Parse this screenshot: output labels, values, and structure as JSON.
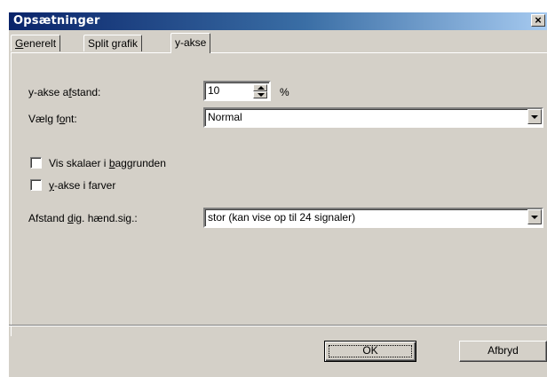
{
  "window": {
    "title": "Opsætninger",
    "close_glyph": "×"
  },
  "tabs": [
    {
      "label_pre": "",
      "mnemonic": "G",
      "label_post": "enerelt",
      "active": false
    },
    {
      "label_pre": "Split grafik",
      "mnemonic": "",
      "label_post": "",
      "active": false
    },
    {
      "label_pre": "y-akse",
      "mnemonic": "",
      "label_post": "",
      "active": true
    }
  ],
  "form": {
    "axis_distance": {
      "label_pre": "y-akse a",
      "mnemonic": "f",
      "label_post": "stand:",
      "value": "10",
      "unit": "%"
    },
    "font": {
      "label_pre": "Vælg f",
      "mnemonic": "o",
      "label_post": "nt:",
      "value": "Normal"
    },
    "show_scales": {
      "label_pre": "Vis skalaer i ",
      "mnemonic": "b",
      "label_post": "aggrunden",
      "checked": false
    },
    "axis_colors": {
      "label_pre": "",
      "mnemonic": "y",
      "label_post": "-akse i farver",
      "checked": false
    },
    "digital_spacing": {
      "label_pre": "Afstand ",
      "mnemonic": "d",
      "label_post": "ig. hænd.sig.:",
      "value": "stor (kan vise op til 24 signaler)"
    }
  },
  "buttons": {
    "ok": "OK",
    "cancel": "Afbryd"
  },
  "colors": {
    "title_bar_start": "#0a246a",
    "title_bar_end": "#a6caf0",
    "face": "#d4d0c8"
  }
}
